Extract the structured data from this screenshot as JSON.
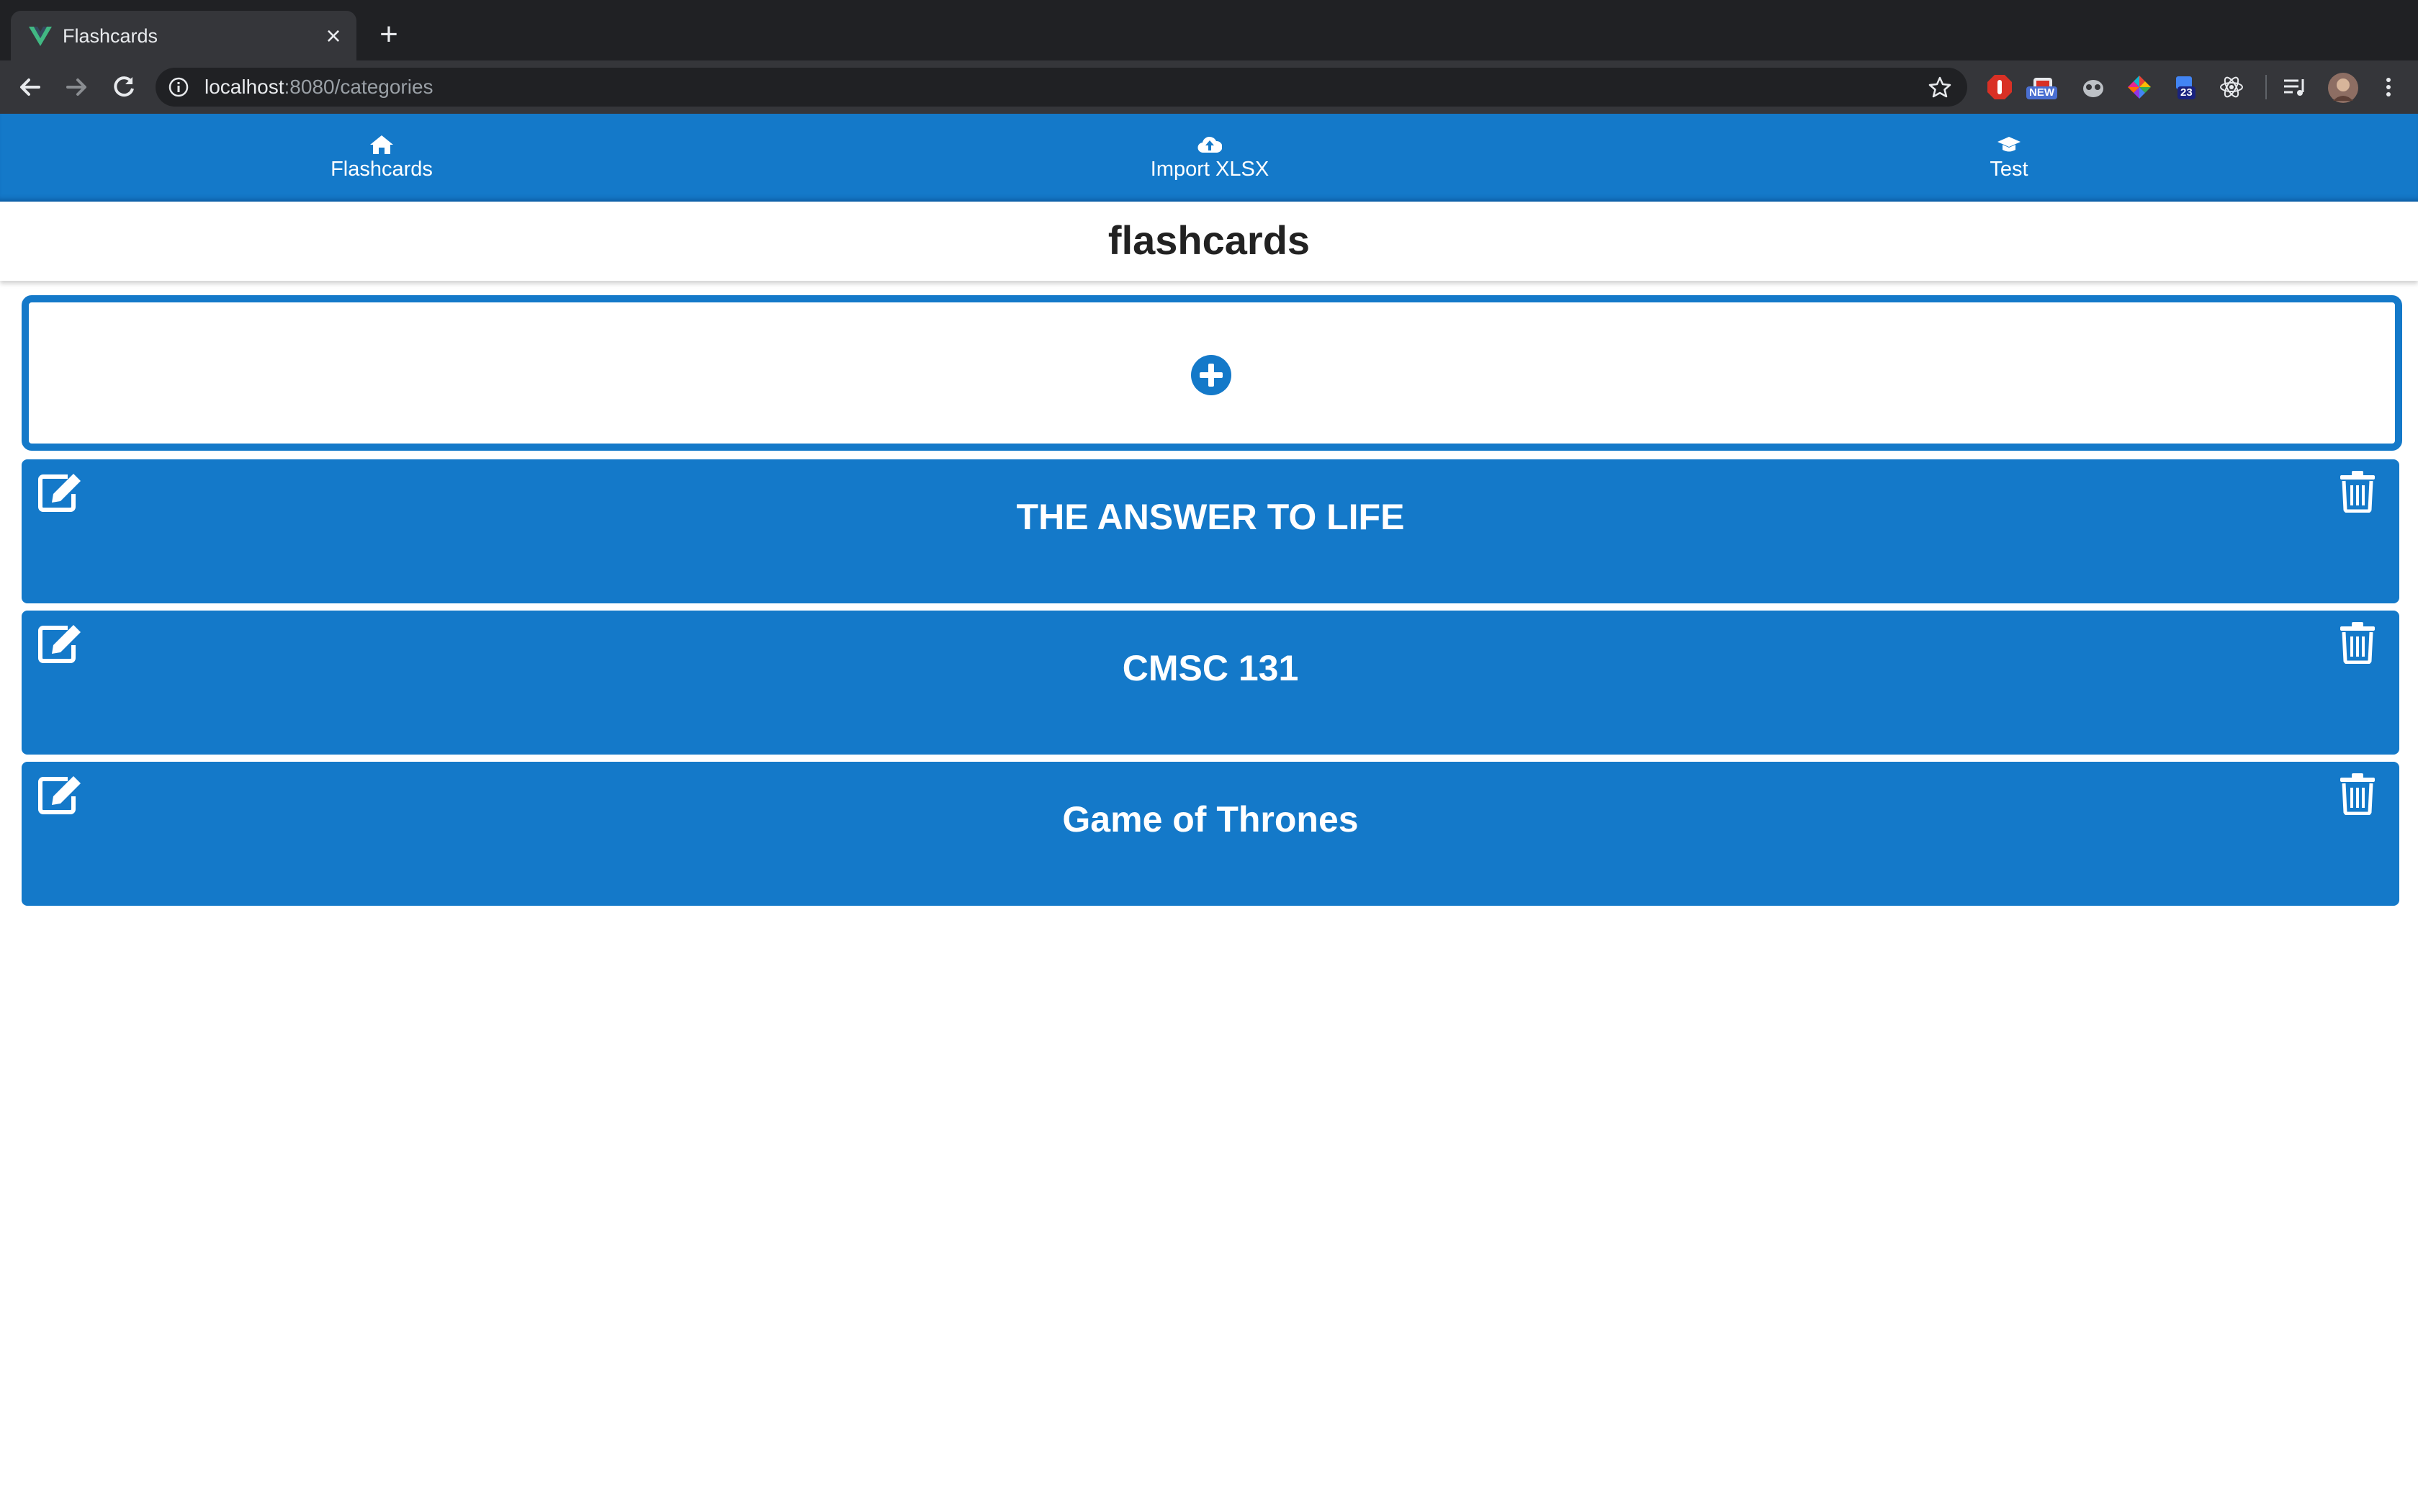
{
  "browser": {
    "tab_title": "Flashcards",
    "url_host": "localhost",
    "url_rest": ":8080/categories",
    "extensions": [
      {
        "name": "stop-extension-icon"
      },
      {
        "name": "new-badge-extension-icon",
        "badge": "NEW"
      },
      {
        "name": "owl-extension-icon"
      },
      {
        "name": "color-wheel-extension-icon"
      },
      {
        "name": "notes-extension-icon",
        "badge": "23"
      },
      {
        "name": "react-devtools-icon"
      }
    ],
    "colors": {
      "chrome_dark": "#202124",
      "chrome_toolbar": "#35363a"
    }
  },
  "nav": {
    "items": [
      {
        "label": "Flashcards",
        "icon": "home-icon"
      },
      {
        "label": "Import XLSX",
        "icon": "cloud-upload-icon"
      },
      {
        "label": "Test",
        "icon": "graduation-cap-icon"
      }
    ],
    "color": "#1479c9"
  },
  "header": {
    "title": "flashcards"
  },
  "categories": [
    {
      "title": "THE ANSWER TO LIFE"
    },
    {
      "title": "CMSC 131"
    },
    {
      "title": "Game of Thrones"
    }
  ]
}
